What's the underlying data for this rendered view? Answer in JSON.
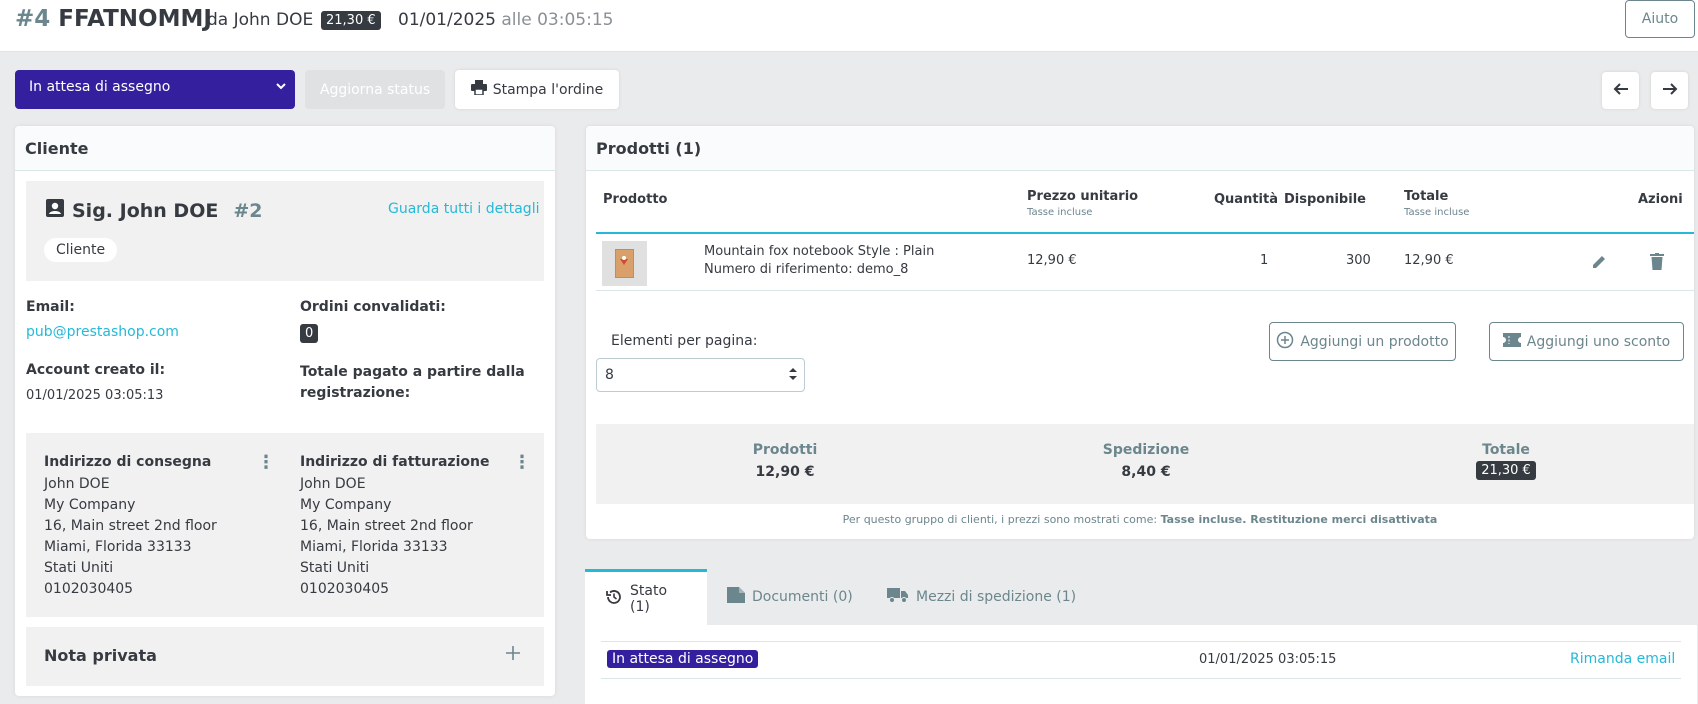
{
  "header": {
    "order_number": "#4",
    "order_reference": "FFATNOMMJ",
    "customer_by": "da John DOE",
    "total": "21,30 €",
    "date": "01/01/2025",
    "time": "alle 03:05:15",
    "help": "Aiuto"
  },
  "toolbar": {
    "status": "In attesa di assegno",
    "update_status": "Aggiorna status",
    "print_order": "Stampa l'ordine"
  },
  "customer_card": {
    "title": "Cliente",
    "name": "Sig. John DOE",
    "id": "#2",
    "view_details": "Guarda tutti i dettagli",
    "group": "Cliente",
    "email_label": "Email:",
    "email": "pub@prestashop.com",
    "validated_orders_label": "Ordini convalidati:",
    "validated_orders": "0",
    "account_created_label": "Account creato il:",
    "account_created": "01/01/2025 03:05:13",
    "total_spent_label": "Totale pagato a partire dalla registrazione:",
    "shipping_address": {
      "title": "Indirizzo di consegna",
      "lines": [
        "John DOE",
        "My Company",
        "16, Main street 2nd floor",
        "Miami, Florida 33133",
        "Stati Uniti",
        "0102030405"
      ]
    },
    "invoice_address": {
      "title": "Indirizzo di fatturazione",
      "lines": [
        "John DOE",
        "My Company",
        "16, Main street 2nd floor",
        "Miami, Florida 33133",
        "Stati Uniti",
        "0102030405"
      ]
    },
    "private_note": "Nota privata"
  },
  "products_card": {
    "title": "Prodotti (1)",
    "columns": {
      "product": "Prodotto",
      "unit_price": "Prezzo unitario",
      "unit_price_sub": "Tasse incluse",
      "quantity": "Quantità",
      "available": "Disponibile",
      "total": "Totale",
      "total_sub": "Tasse incluse",
      "actions": "Azioni"
    },
    "rows": [
      {
        "name": "Mountain fox notebook Style : Plain",
        "reference": "Numero di riferimento: demo_8",
        "unit_price": "12,90 €",
        "quantity": "1",
        "available": "300",
        "total": "12,90 €"
      }
    ],
    "per_page_label": "Elementi per pagina:",
    "per_page_value": "8",
    "add_product": "Aggiungi un prodotto",
    "add_discount": "Aggiungi uno sconto",
    "summary": {
      "products_label": "Prodotti",
      "products_value": "12,90 €",
      "shipping_label": "Spedizione",
      "shipping_value": "8,40 €",
      "total_label": "Totale",
      "total_value": "21,30 €"
    },
    "footnote_prefix": "Per questo gruppo di clienti, i prezzi sono mostrati come:",
    "footnote_bold": "Tasse incluse. Restituzione merci disattivata"
  },
  "tabs": [
    {
      "label": "Stato (1)",
      "icon": "history-icon"
    },
    {
      "label": "Documenti (0)",
      "icon": "document-icon"
    },
    {
      "label": "Mezzi di spedizione (1)",
      "icon": "truck-icon"
    }
  ],
  "history": {
    "status": "In attesa di assegno",
    "date": "01/01/2025 03:05:15",
    "resend": "Rimanda email"
  },
  "colors": {
    "status_purple": "#34209e",
    "link": "#25b9d7",
    "dark": "#363a41"
  }
}
